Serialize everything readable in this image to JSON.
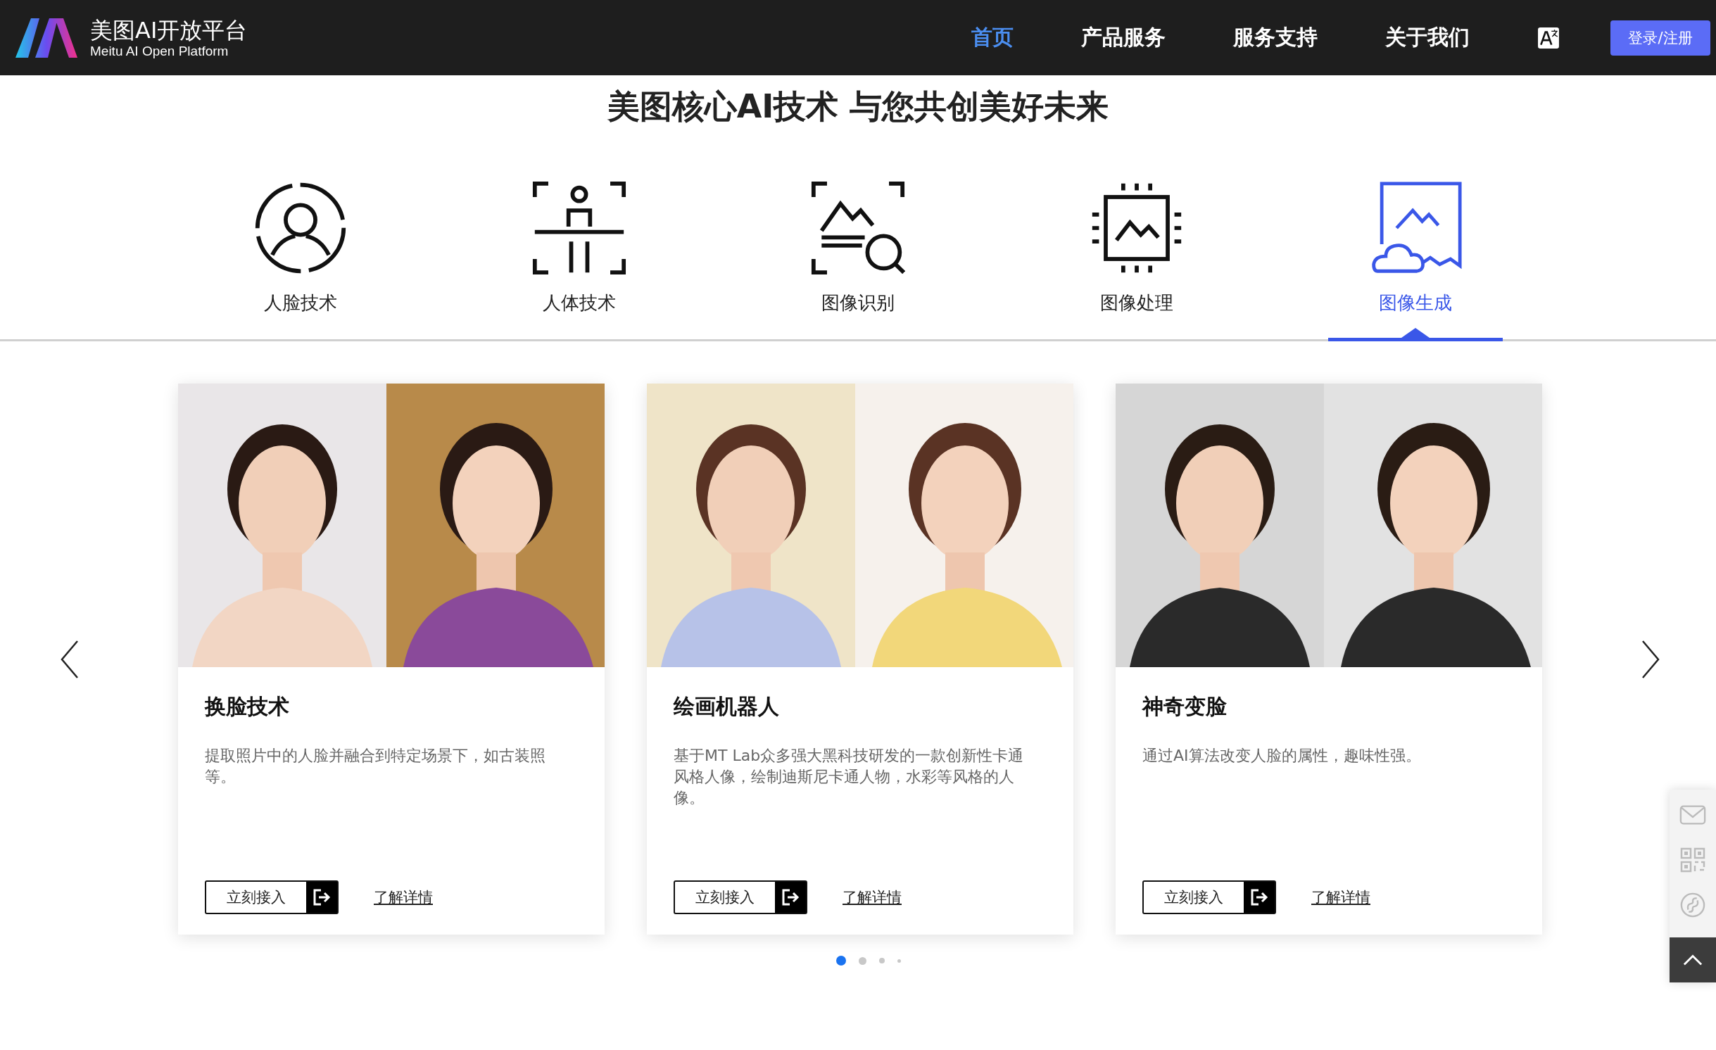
{
  "header": {
    "brand_name": "美图AI开放平台",
    "brand_sub": "Meitu AI Open Platform",
    "nav": [
      {
        "label": "首页",
        "selected": true
      },
      {
        "label": "产品服务",
        "selected": false
      },
      {
        "label": "服务支持",
        "selected": false
      },
      {
        "label": "关于我们",
        "selected": false
      }
    ],
    "login_button": "登录/注册"
  },
  "headline": "美图核心AI技术 与您共创美好未来",
  "tabs": [
    {
      "label": "人脸技术",
      "kind": "face",
      "selected": false
    },
    {
      "label": "人体技术",
      "kind": "body",
      "selected": false
    },
    {
      "label": "图像识别",
      "kind": "recognize",
      "selected": false
    },
    {
      "label": "图像处理",
      "kind": "process",
      "selected": false
    },
    {
      "label": "图像生成",
      "kind": "generate",
      "selected": true
    }
  ],
  "cards": [
    {
      "title": "换脸技术",
      "description": "提取照片中的人脸并融合到特定场景下，如古装照等。",
      "primary_button": "立刻接入",
      "link": "了解详情"
    },
    {
      "title": "绘画机器人",
      "description": "基于MT Lab众多强大黑科技研发的一款创新性卡通风格人像，绘制迪斯尼卡通人物，水彩等风格的人像。",
      "primary_button": "立刻接入",
      "link": "了解详情"
    },
    {
      "title": "神奇变脸",
      "description": "通过AI算法改变人脸的属性，趣味性强。",
      "primary_button": "立刻接入",
      "link": "了解详情"
    }
  ],
  "pager": [
    {
      "selected": true
    },
    {
      "selected": false
    },
    {
      "selected": false
    },
    {
      "selected": false
    }
  ]
}
